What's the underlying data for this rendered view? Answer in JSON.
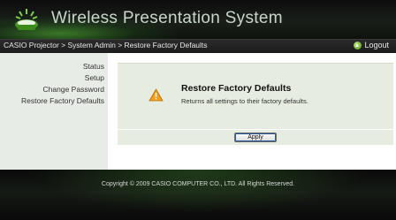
{
  "header": {
    "title": "Wireless Presentation System"
  },
  "breadcrumb": "CASIO Projector > System Admin > Restore Factory Defaults",
  "logout_label": "Logout",
  "sidebar": {
    "items": [
      {
        "label": "Status"
      },
      {
        "label": "Setup"
      },
      {
        "label": "Change Password"
      },
      {
        "label": "Restore Factory Defaults"
      }
    ]
  },
  "panel": {
    "title": "Restore Factory Defaults",
    "description": "Returns all settings to their factory defaults.",
    "icon": "warning-icon"
  },
  "apply_label": "Apply",
  "footer": {
    "copyright": "Copyright © 2009 CASIO COMPUTER CO., LTD. All Rights Reserved."
  },
  "colors": {
    "accent_green": "#4a9a1a",
    "panel_bg": "#e6ece0",
    "sidebar_bg": "#e8ece6"
  }
}
